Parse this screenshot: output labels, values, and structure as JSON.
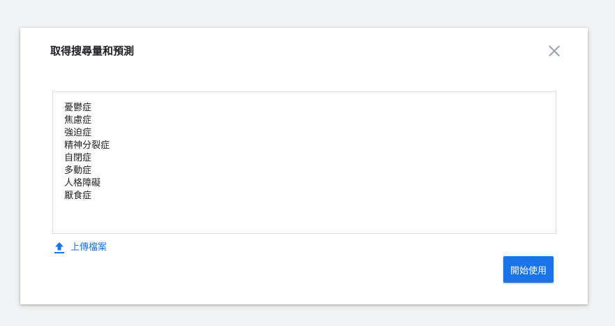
{
  "dialog": {
    "title": "取得搜尋量和預測",
    "close_icon": "close-icon"
  },
  "keywords_input": {
    "lines": [
      "憂鬱症",
      "焦慮症",
      "強迫症",
      "精神分裂症",
      "自閉症",
      "多動症",
      "人格障礙",
      "厭食症"
    ]
  },
  "upload": {
    "icon": "upload-icon",
    "label": "上傳檔案"
  },
  "actions": {
    "start_label": "開始使用"
  },
  "colors": {
    "accent": "#1a73e8",
    "close_icon": "#9aa0a6",
    "background": "#f1f3f4"
  }
}
